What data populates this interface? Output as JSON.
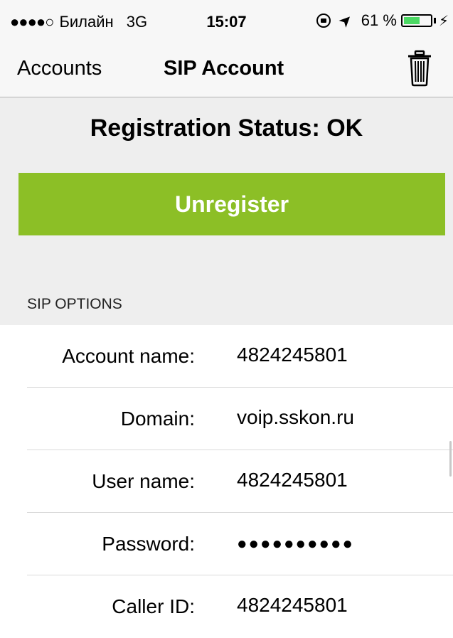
{
  "status_bar": {
    "signal": "●●●●○",
    "carrier": "Билайн",
    "network": "3G",
    "time": "15:07",
    "location_glyph": "➤",
    "battery_percent_label": "61 %",
    "battery_level": 0.61,
    "charging_glyph": "⚡"
  },
  "nav": {
    "back_label": "Accounts",
    "title": "SIP Account",
    "trash_icon": "trash-icon"
  },
  "registration": {
    "status_text": "Registration Status: OK",
    "button_label": "Unregister",
    "button_color": "#8cbf26"
  },
  "sip_options": {
    "header": "SIP OPTIONS",
    "fields": [
      {
        "label": "Account name:",
        "value": "4824245801"
      },
      {
        "label": "Domain:",
        "value": "voip.sskon.ru"
      },
      {
        "label": "User name:",
        "value": "4824245801"
      },
      {
        "label": "Password:",
        "value": "●●●●●●●●●●"
      },
      {
        "label": "Caller ID:",
        "value": "4824245801"
      }
    ]
  }
}
